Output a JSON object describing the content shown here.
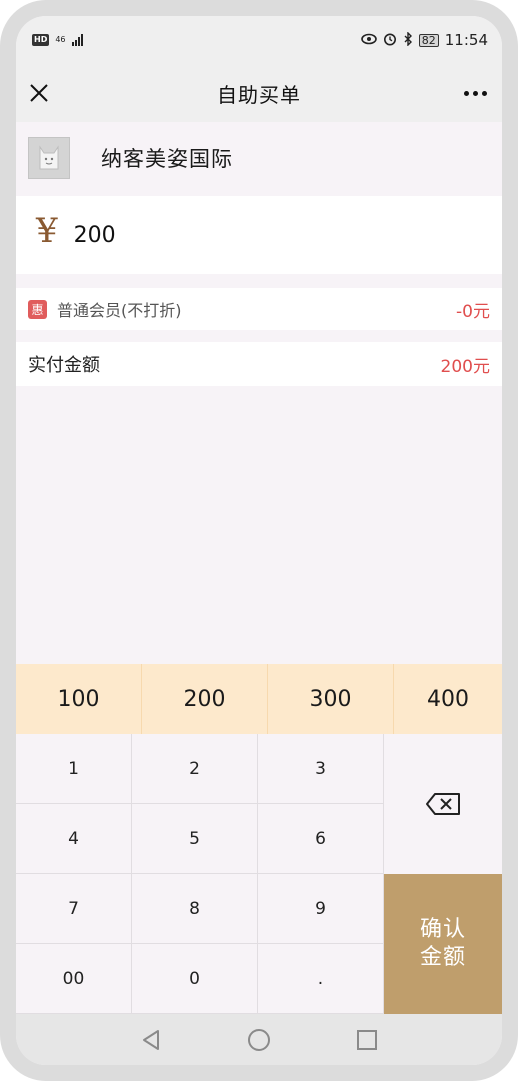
{
  "status_bar": {
    "hd": "HD",
    "network": "46",
    "battery": "82",
    "time": "11:54",
    "icons": [
      "eye-icon",
      "alarm-icon",
      "bluetooth-icon"
    ]
  },
  "header": {
    "title": "自助买单",
    "close_icon": "close-icon",
    "more_icon": "more-icon"
  },
  "merchant": {
    "name": "纳客美姿国际"
  },
  "amount": {
    "currency": "¥",
    "value": "200"
  },
  "discount": {
    "badge": "惠",
    "label": "普通会员(不打折)",
    "value": "-0元"
  },
  "total": {
    "label": "实付金额",
    "value": "200元"
  },
  "quick_amounts": [
    "100",
    "200",
    "300",
    "400"
  ],
  "keypad": {
    "keys": [
      "1",
      "2",
      "3",
      "4",
      "5",
      "6",
      "7",
      "8",
      "9",
      "00",
      "0",
      "."
    ],
    "backspace_icon": "backspace-icon",
    "confirm_line1": "确认",
    "confirm_line2": "金额"
  },
  "colors": {
    "accent_gold": "#bf9e6c",
    "quick_bg": "#fde9cc",
    "price_red": "#e04e4e",
    "currency_brown": "#8a5a32"
  },
  "nav_bar": [
    "back-icon",
    "home-icon",
    "recents-icon"
  ]
}
